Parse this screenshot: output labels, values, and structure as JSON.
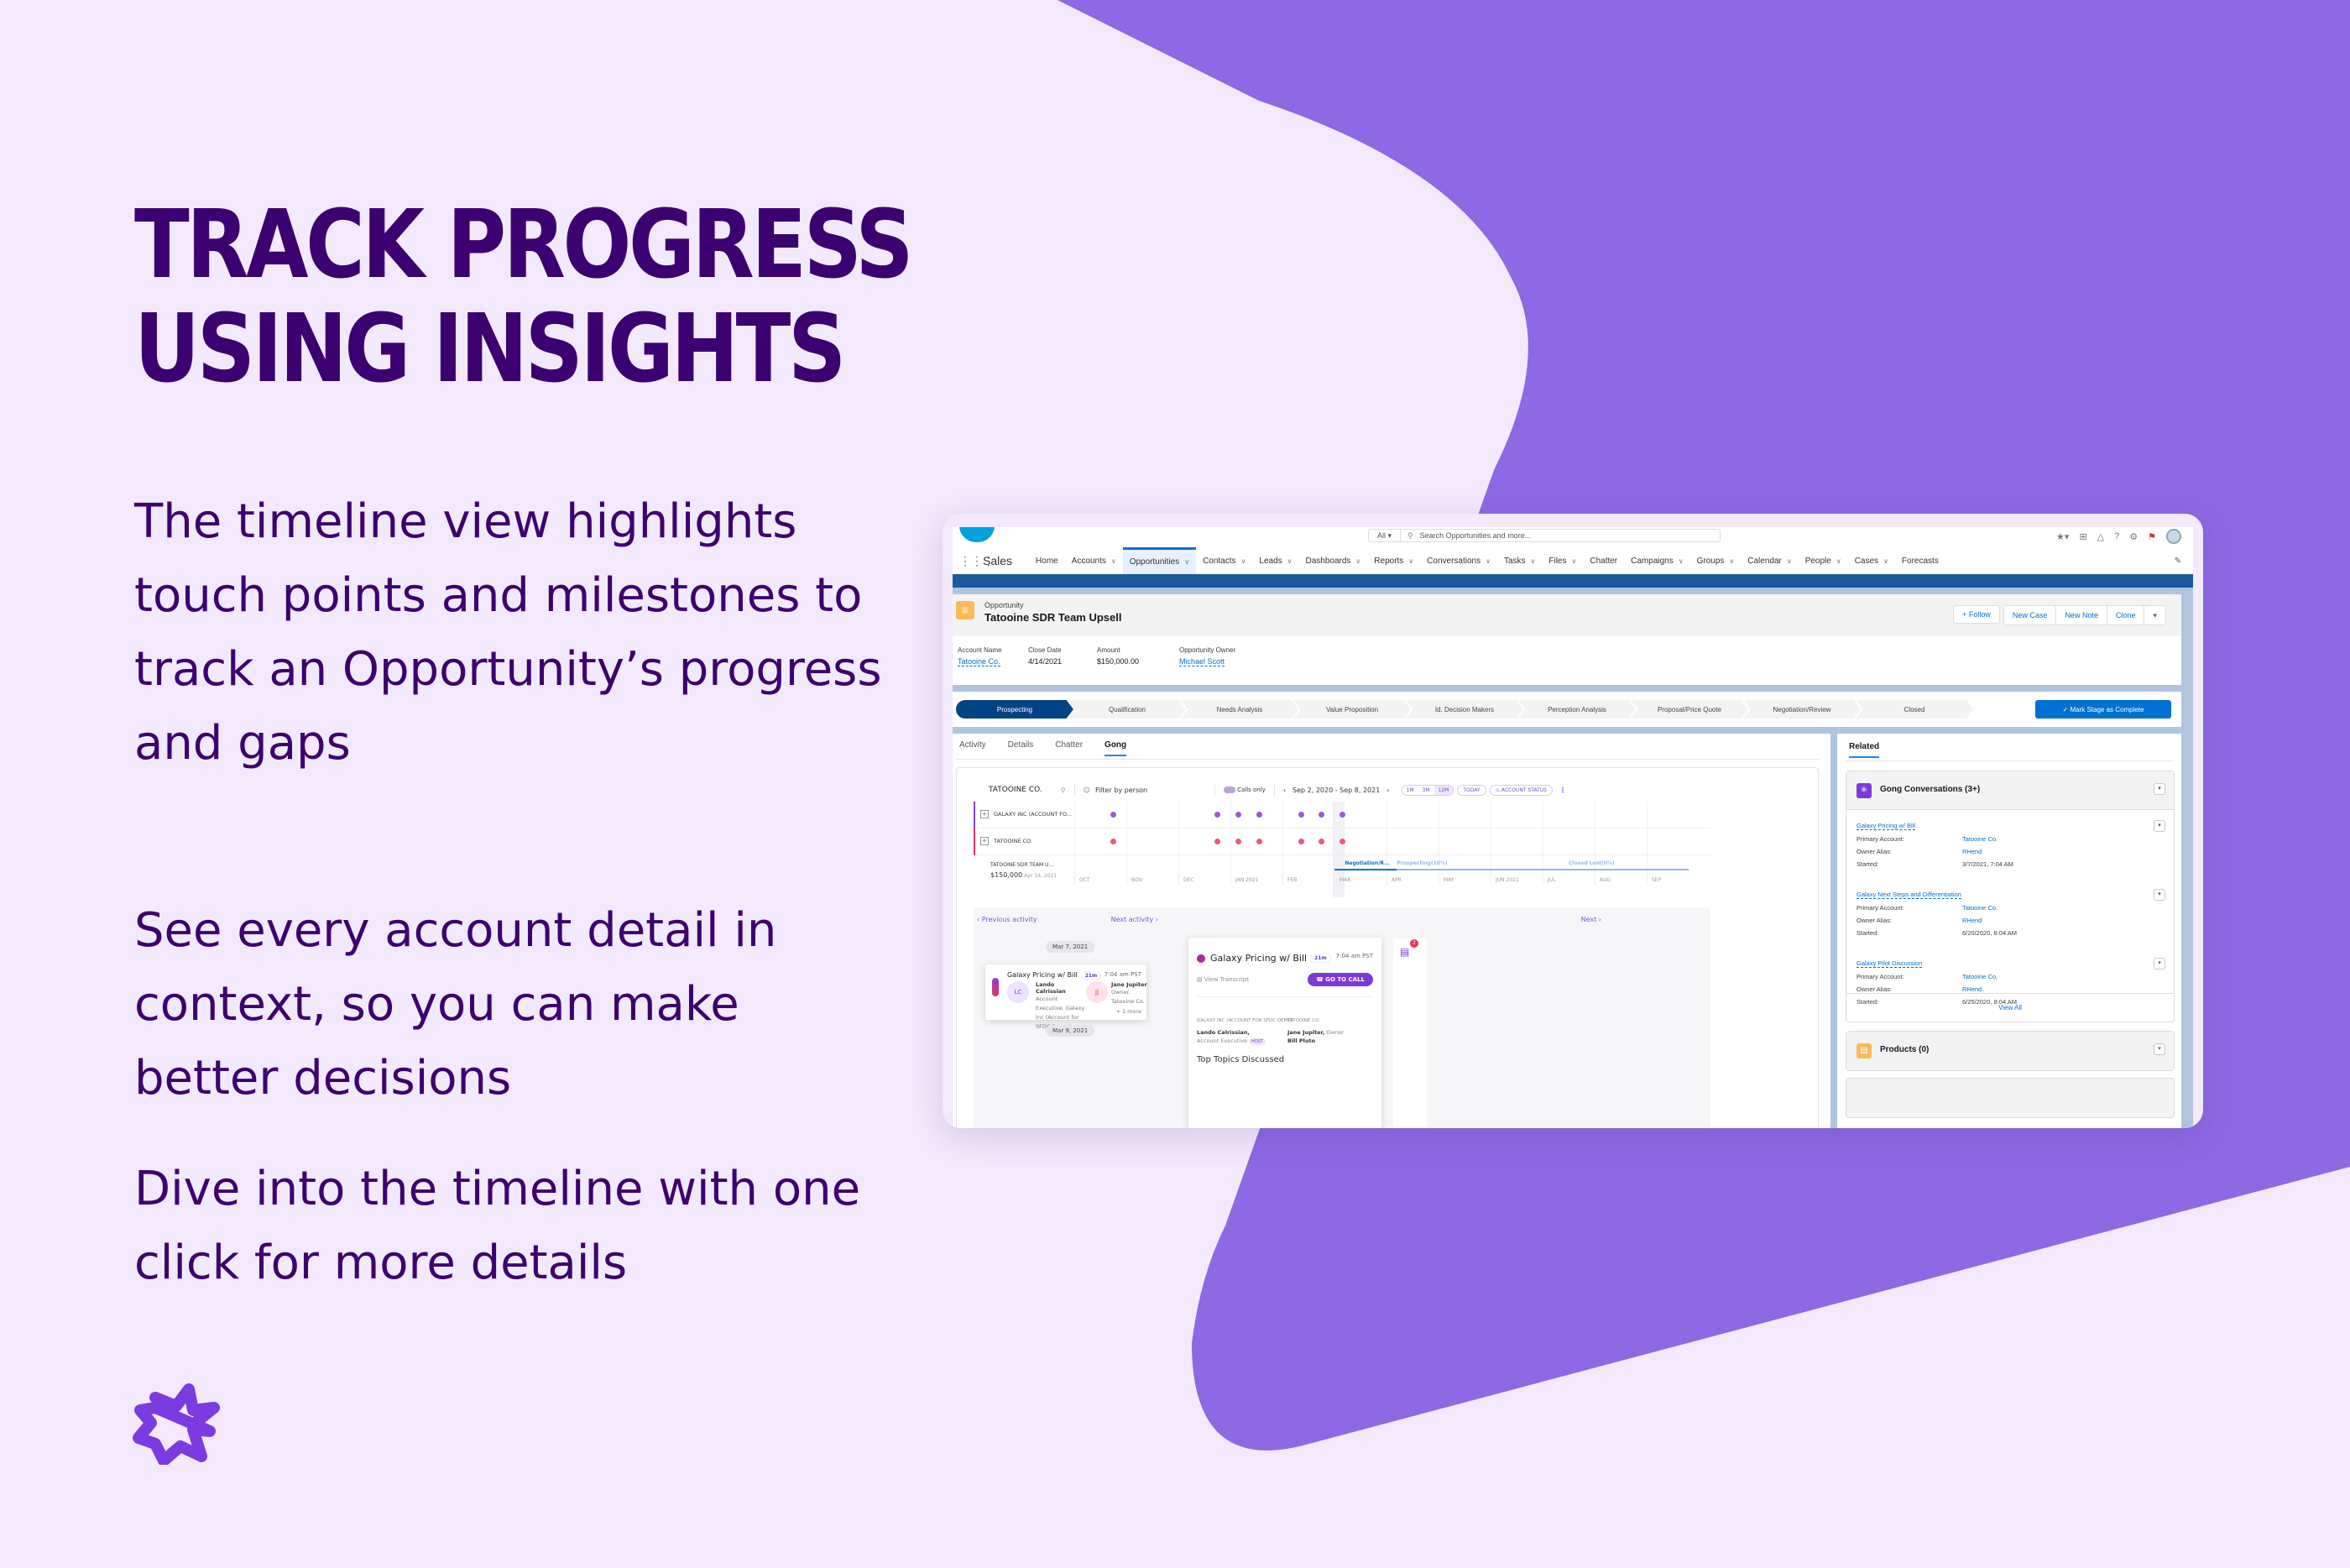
{
  "hero": {
    "title_line1": "TRACK PROGRESS",
    "title_line2": "USING INSIGHTS",
    "paragraphs": [
      "The timeline view highlights touch points and milestones to track an Opportunity’s progress and gaps",
      "See every account detail in context, so you can make better decisions",
      "Dive into the timeline with one click for more details"
    ]
  },
  "colors": {
    "page_bg": "#f3e9fd",
    "accent_purple": "#8f68e4",
    "title": "#3d0070",
    "logo": "#7a3ce0",
    "sf_blue": "#0070d2",
    "sf_dark_blue": "#014486",
    "gong_purple": "#7d3ad8",
    "dot_purple": "#9b59d6",
    "dot_red": "#f05a6e"
  },
  "salesforce": {
    "search": {
      "scope": "All ▾",
      "placeholder": "Search Opportunities and more..."
    },
    "app_name": "Sales",
    "nav": [
      {
        "label": "Home",
        "chevron": false
      },
      {
        "label": "Accounts",
        "chevron": true
      },
      {
        "label": "Opportunities",
        "chevron": true,
        "active": true
      },
      {
        "label": "Contacts",
        "chevron": true
      },
      {
        "label": "Leads",
        "chevron": true
      },
      {
        "label": "Dashboards",
        "chevron": true
      },
      {
        "label": "Reports",
        "chevron": true
      },
      {
        "label": "Conversations",
        "chevron": true
      },
      {
        "label": "Tasks",
        "chevron": true
      },
      {
        "label": "Files",
        "chevron": true
      },
      {
        "label": "Chatter",
        "chevron": false
      },
      {
        "label": "Campaigns",
        "chevron": true
      },
      {
        "label": "Groups",
        "chevron": true
      },
      {
        "label": "Calendar",
        "chevron": true
      },
      {
        "label": "People",
        "chevron": true
      },
      {
        "label": "Cases",
        "chevron": true
      },
      {
        "label": "Forecasts",
        "chevron": false
      }
    ],
    "record": {
      "type": "Opportunity",
      "name": "Tatooine SDR Team Upsell",
      "actions": {
        "follow": "+ Follow",
        "new_case": "New Case",
        "new_note": "New Note",
        "clone": "Clone",
        "more": "▾"
      },
      "fields": [
        {
          "label": "Account Name",
          "value": "Tatooine Co.",
          "link": true
        },
        {
          "label": "Close Date",
          "value": "4/14/2021",
          "link": false
        },
        {
          "label": "Amount",
          "value": "$150,000.00",
          "link": false
        },
        {
          "label": "Opportunity Owner",
          "value": "Michael Scott",
          "link": true
        }
      ]
    },
    "stages": [
      "Prospecting",
      "Qualification",
      "Needs Analysis",
      "Value Proposition",
      "Id. Decision Makers",
      "Perception Analysis",
      "Proposal/Price Quote",
      "Negotiation/Review",
      "Closed"
    ],
    "current_stage": "Prospecting",
    "mark_complete": "✓ Mark Stage as Complete",
    "tabs": [
      "Activity",
      "Details",
      "Chatter",
      "Gong"
    ],
    "active_tab": "Gong",
    "related_tab": "Related"
  },
  "gong": {
    "account": "TATOOINE CO.",
    "filter": "Filter by person",
    "calls_only": "Calls only",
    "date_range": "Sep 2, 2020 - Sep 8, 2021",
    "ranges": [
      "1M",
      "3M",
      "12M"
    ],
    "active_range": "12M",
    "today": "TODAY",
    "account_status": "⚠ ACCOUNT STATUS",
    "rows": [
      {
        "label": "GALAXY INC (ACCOUNT FO...",
        "color": "#9b59d6"
      },
      {
        "label": "TATOOINE CO.",
        "color": "#f05a6e"
      }
    ],
    "opportunity": {
      "name": "TATOOINE SDR TEAM U...",
      "amount": "$150,000",
      "date": "Apr 14, 2021"
    },
    "stage_markers": [
      "Negotiation/R...",
      "Prospecting(10%)",
      "Closed Lost(0%)"
    ],
    "months": [
      "OCT",
      "NOV",
      "DEC",
      "JAN 2021",
      "FEB",
      "MAR",
      "APR",
      "MAY",
      "JUN 2021",
      "JUL",
      "AUG",
      "SEP"
    ],
    "activity_months_index": [
      0.7,
      2.7,
      3.1,
      3.5,
      4.3,
      4.7,
      5.1
    ],
    "prev_activity": "‹ Previous activity",
    "next_activity": "Next activity ›",
    "next": "Next ›",
    "date_chip_1": "Mar 7, 2021",
    "date_chip_2": "Mar 9, 2021",
    "event": {
      "title": "Galaxy Pricing w/ Bill",
      "duration": "21m",
      "time": "7:04 am PST",
      "p1_initials": "LC",
      "p1_name": "Lando Calrissian",
      "p1_role": "Account Executive. Galaxy Inc (Account for SFDC Demo)",
      "p2_initials": "JJ",
      "p2_name": "Jane Jupiter",
      "p2_role": "Owner. Tatooine Co.",
      "more": "+ 1 more"
    },
    "detail": {
      "view_transcript": "View Transcript",
      "go_to_call": "☎ GO TO CALL",
      "company1": "GALAXY INC (ACCOUNT FOR SFDC DEMO)",
      "company2": "TATOOINE CO.",
      "p1": "Lando Calrissian,",
      "p1_role": "Account Executive",
      "host": "HOST",
      "p2": "Jane Jupiter,",
      "p2_role": "Owner",
      "p3": "Bill Pluto",
      "topics": "Top Topics Discussed"
    },
    "comments_badge": "2"
  },
  "related": {
    "gong_conversations": "Gong Conversations (3+)",
    "conversations": [
      {
        "title": "Galaxy Pricing w/ Bill",
        "primary_account": "Tatooine Co.",
        "owner_alias": "RHend",
        "started": "3/7/2021, 7:04 AM"
      },
      {
        "title": "Galaxy Next Steps and Differentiation",
        "primary_account": "Tatooine Co.",
        "owner_alias": "RHend",
        "started": "6/20/2020, 8:04 AM"
      },
      {
        "title": "Galaxy Pilot Discussion",
        "primary_account": "Tatooine Co.",
        "owner_alias": "RHend",
        "started": "6/25/2020, 8:04 AM"
      }
    ],
    "labels": {
      "primary_account": "Primary Account:",
      "owner_alias": "Owner Alias:",
      "started": "Started:"
    },
    "view_all": "View All",
    "products": "Products (0)"
  }
}
